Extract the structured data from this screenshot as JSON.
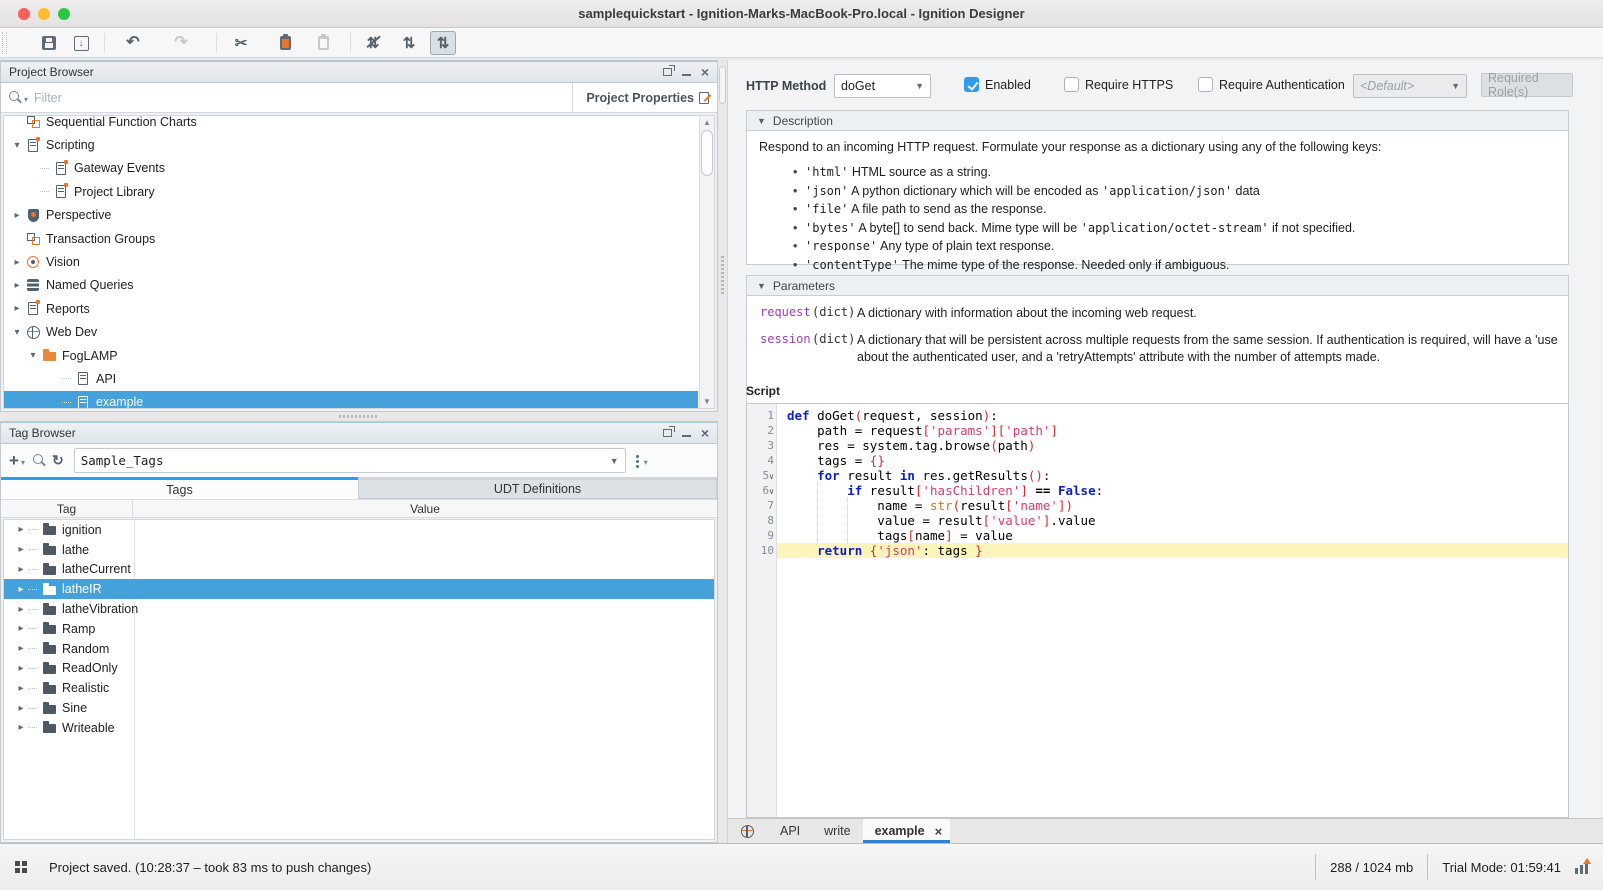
{
  "window": {
    "title": "samplequickstart - Ignition-Marks-MacBook-Pro.local - Ignition Designer"
  },
  "toolbar": {
    "icons": [
      "save",
      "save-import",
      "undo",
      "redo",
      "cut",
      "copy",
      "paste",
      "compare-off",
      "compare",
      "split-compare"
    ],
    "active_icon": "split-compare",
    "disabled_icons": [
      "redo",
      "paste"
    ]
  },
  "project_browser": {
    "title": "Project Browser",
    "filter_placeholder": "Filter",
    "properties_label": "Project Properties",
    "tree": [
      {
        "label": "Sequential Function Charts",
        "level": 1,
        "icon": "sfc-icon"
      },
      {
        "label": "Scripting",
        "level": 1,
        "icon": "scripting-icon",
        "expanded": true
      },
      {
        "label": "Gateway Events",
        "level": 2,
        "icon": "gateway-events-icon",
        "dash": true
      },
      {
        "label": "Project Library",
        "level": 2,
        "icon": "project-library-icon",
        "dash": true
      },
      {
        "label": "Perspective",
        "level": 1,
        "icon": "perspective-icon",
        "expanded": false
      },
      {
        "label": "Transaction Groups",
        "level": 1,
        "icon": "transaction-groups-icon"
      },
      {
        "label": "Vision",
        "level": 1,
        "icon": "vision-icon",
        "expanded": false
      },
      {
        "label": "Named Queries",
        "level": 1,
        "icon": "named-queries-icon",
        "expanded": false
      },
      {
        "label": "Reports",
        "level": 1,
        "icon": "reports-icon",
        "expanded": false
      },
      {
        "label": "Web Dev",
        "level": 1,
        "icon": "web-dev-icon",
        "expanded": true
      },
      {
        "label": "FogLAMP",
        "level": 2,
        "icon": "folder-icon",
        "expanded": true
      },
      {
        "label": "API",
        "level": 3,
        "icon": "page-icon",
        "dash": true
      },
      {
        "label": "example",
        "level": 3,
        "icon": "page-icon",
        "dash": true,
        "selected": true
      }
    ]
  },
  "tag_browser": {
    "title": "Tag Browser",
    "provider": "Sample_Tags",
    "tabs": {
      "tags": "Tags",
      "udt": "UDT Definitions",
      "active": "Tags"
    },
    "columns": {
      "tag": "Tag",
      "value": "Value"
    },
    "rows": [
      {
        "label": "ignition"
      },
      {
        "label": "lathe"
      },
      {
        "label": "latheCurrent"
      },
      {
        "label": "latheIR",
        "selected": true
      },
      {
        "label": "latheVibration"
      },
      {
        "label": "Ramp"
      },
      {
        "label": "Random"
      },
      {
        "label": "ReadOnly"
      },
      {
        "label": "Realistic"
      },
      {
        "label": "Sine"
      },
      {
        "label": "Writeable"
      }
    ]
  },
  "endpoint": {
    "http_method_label": "HTTP Method",
    "http_method_value": "doGet",
    "enabled_label": "Enabled",
    "enabled_checked": true,
    "require_https_label": "Require HTTPS",
    "require_https_checked": false,
    "require_auth_label": "Require Authentication",
    "require_auth_checked": false,
    "default_value": "<Default>",
    "required_roles_placeholder": "Required Role(s)"
  },
  "description": {
    "header": "Description",
    "intro": "Respond to an incoming HTTP request. Formulate your response as a dictionary using any of the following keys:",
    "bullets": [
      [
        {
          "c": 1,
          "t": "'html'"
        },
        {
          "t": " HTML source as a string."
        }
      ],
      [
        {
          "c": 1,
          "t": "'json'"
        },
        {
          "t": " A python dictionary which will be encoded as "
        },
        {
          "c": 1,
          "t": "'application/json'"
        },
        {
          "t": " data"
        }
      ],
      [
        {
          "c": 1,
          "t": "'file'"
        },
        {
          "t": " A file path to send as the response."
        }
      ],
      [
        {
          "c": 1,
          "t": "'bytes'"
        },
        {
          "t": " A byte[] to send back. Mime type will be "
        },
        {
          "c": 1,
          "t": "'application/octet-stream'"
        },
        {
          "t": " if not specified."
        }
      ],
      [
        {
          "c": 1,
          "t": "'response'"
        },
        {
          "t": " Any type of plain text response."
        }
      ],
      [
        {
          "c": 1,
          "t": "'contentType'"
        },
        {
          "t": " The mime type of the response. Needed only if ambiguous."
        }
      ]
    ]
  },
  "parameters": {
    "header": "Parameters",
    "rows": [
      {
        "name": "request",
        "type": "(dict)",
        "desc": [
          "A dictionary with information about the incoming web request."
        ]
      },
      {
        "name": "session",
        "type": "(dict)",
        "desc": [
          "A dictionary that will be persistent across multiple requests from the same session. If authentication is required, will have a 'use",
          "about the authenticated user, and a 'retryAttempts' attribute with the number of attempts made."
        ]
      }
    ]
  },
  "script": {
    "label": "Script",
    "lines": [
      {
        "n": 1,
        "tokens": [
          [
            "k",
            "def"
          ],
          [
            "p",
            " doGet"
          ],
          [
            "b",
            "("
          ],
          [
            "p",
            "request, session"
          ],
          [
            "b",
            ")"
          ],
          [
            "p",
            ":"
          ]
        ]
      },
      {
        "n": 2,
        "tokens": [
          [
            "p",
            "    path = request"
          ],
          [
            "b",
            "["
          ],
          [
            "s",
            "'params'"
          ],
          [
            "b",
            "]"
          ],
          [
            "b",
            "["
          ],
          [
            "s",
            "'path'"
          ],
          [
            "b",
            "]"
          ]
        ]
      },
      {
        "n": 3,
        "tokens": [
          [
            "p",
            "    res = system.tag.browse"
          ],
          [
            "b",
            "("
          ],
          [
            "p",
            "path"
          ],
          [
            "b",
            ")"
          ]
        ]
      },
      {
        "n": 4,
        "tokens": [
          [
            "p",
            "    tags = "
          ],
          [
            "b",
            "{}"
          ]
        ]
      },
      {
        "n": 5,
        "fold": true,
        "tokens": [
          [
            "p",
            "    "
          ],
          [
            "k",
            "for"
          ],
          [
            "p",
            " result "
          ],
          [
            "k",
            "in"
          ],
          [
            "p",
            " res.getResults"
          ],
          [
            "b",
            "()"
          ],
          [
            "p",
            ":"
          ]
        ]
      },
      {
        "n": 6,
        "fold": true,
        "tokens": [
          [
            "p",
            "        "
          ],
          [
            "k",
            "if"
          ],
          [
            "p",
            " result"
          ],
          [
            "b",
            "["
          ],
          [
            "s",
            "'hasChildren'"
          ],
          [
            "b",
            "]"
          ],
          [
            "o",
            " == "
          ],
          [
            "k",
            "False"
          ],
          [
            "p",
            ":"
          ]
        ]
      },
      {
        "n": 7,
        "tokens": [
          [
            "p",
            "            name = "
          ],
          [
            "f",
            "str"
          ],
          [
            "b",
            "("
          ],
          [
            "p",
            "result"
          ],
          [
            "b",
            "["
          ],
          [
            "s",
            "'name'"
          ],
          [
            "b",
            "]"
          ],
          [
            "b",
            ")"
          ]
        ]
      },
      {
        "n": 8,
        "tokens": [
          [
            "p",
            "            value = result"
          ],
          [
            "b",
            "["
          ],
          [
            "s",
            "'value'"
          ],
          [
            "b",
            "]"
          ],
          [
            "p",
            ".value"
          ]
        ]
      },
      {
        "n": 9,
        "tokens": [
          [
            "p",
            "            tags"
          ],
          [
            "b",
            "["
          ],
          [
            "p",
            "name"
          ],
          [
            "b",
            "]"
          ],
          [
            "p",
            " = value"
          ]
        ]
      },
      {
        "n": 10,
        "highlight": true,
        "tokens": [
          [
            "p",
            "    "
          ],
          [
            "k",
            "return"
          ],
          [
            "p",
            " "
          ],
          [
            "b",
            "{"
          ],
          [
            "s",
            "'json'"
          ],
          [
            "p",
            ": tags "
          ],
          [
            "b",
            "}"
          ]
        ]
      }
    ]
  },
  "editor_tabs": {
    "items": [
      {
        "label": "API"
      },
      {
        "label": "write"
      },
      {
        "label": "example",
        "active": true,
        "closable": true
      }
    ]
  },
  "status_bar": {
    "message": "Project saved. (10:28:37 – took 83 ms to push changes)",
    "memory": "288 / 1024 mb",
    "trial": "Trial Mode: 01:59:41"
  },
  "colors": {
    "selection": "#45a1dc",
    "accent_blue": "#2f9ce8",
    "keyword": "#0a1fc4",
    "string": "#d23c6e",
    "builtin": "#c77b21",
    "param_name": "#9b3fbf",
    "highlight_line": "#fbf5b9",
    "orange": "#e8762d"
  }
}
